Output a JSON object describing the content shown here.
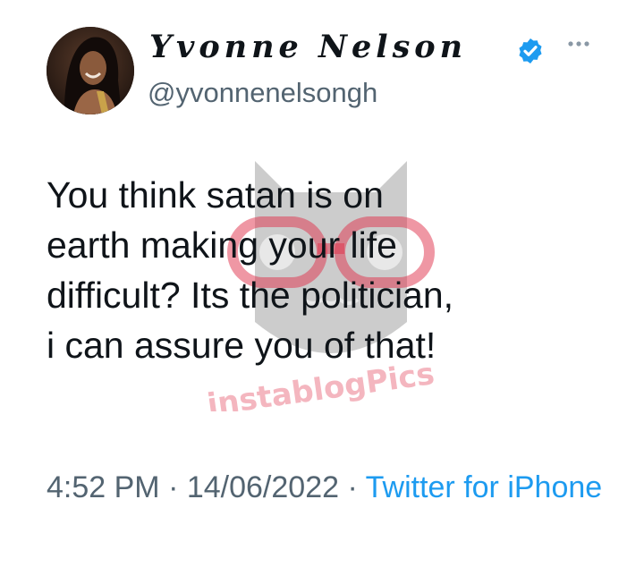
{
  "author": {
    "display_name": "Yvonne Nelson",
    "handle": "@yvonnenelsongh",
    "verified": true
  },
  "tweet": {
    "text": "You think satan is on\nearth making your life\ndifficult? Its the politician,\ni can assure you of that!",
    "time": "4:52 PM",
    "separator": " · ",
    "date": "14/06/2022",
    "source": "Twitter for iPhone"
  },
  "watermark": {
    "text": "instablogPics"
  },
  "icons": {
    "verified": "verified-badge-icon",
    "more": "more-options-icon"
  },
  "colors": {
    "text": "#0f1419",
    "secondary": "#536471",
    "accent": "#1d9bf0",
    "watermark_red": "#e0304a"
  }
}
